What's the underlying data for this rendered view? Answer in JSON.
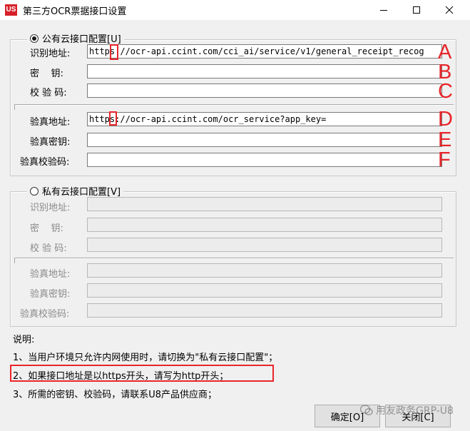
{
  "window": {
    "title": "第三方OCR票据接口设置",
    "logo_text": "US",
    "controls": [
      "minimize-icon",
      "maximize-icon",
      "close-icon"
    ]
  },
  "public_group": {
    "legend": "公有云接口配置[U]",
    "selected": true,
    "fields": [
      {
        "label": "识别地址:",
        "value": "https://ocr-api.ccint.com/cci_ai/service/v1/general_receipt_recog"
      },
      {
        "label": "密    钥:",
        "value": ""
      },
      {
        "label": "校 验 码:",
        "value": ""
      },
      {
        "label": "验真地址:",
        "value": "https://ocr-api.ccint.com/ocr_service?app_key="
      },
      {
        "label": "验真密钥:",
        "value": ""
      },
      {
        "label": "验真校验码:",
        "value": ""
      }
    ],
    "markers": [
      "A",
      "B",
      "C",
      "D",
      "E",
      "F"
    ]
  },
  "private_group": {
    "legend": "私有云接口配置[V]",
    "selected": false,
    "fields": [
      {
        "label": "识别地址:",
        "value": ""
      },
      {
        "label": "密    钥:",
        "value": ""
      },
      {
        "label": "校 验 码:",
        "value": ""
      },
      {
        "label": "验真地址:",
        "value": ""
      },
      {
        "label": "验真密钥:",
        "value": ""
      },
      {
        "label": "验真校验码:",
        "value": ""
      }
    ]
  },
  "notes": {
    "heading": "说明:",
    "items": [
      "1、当用户环境只允许内网使用时，请切换为\"私有云接口配置\"；",
      "2、如果接口地址是以https开头，请写为http开头；",
      "3、所需的密钥、校验码，请联系U8产品供应商；"
    ]
  },
  "buttons": {
    "ok": "确定[O]",
    "close": "关闭[C]"
  },
  "watermark": "用友政务GRP-U8",
  "colors": {
    "accent_red": "#e8262a",
    "logo_red": "#d8202a",
    "dialog_bg": "#f0f0f0"
  }
}
